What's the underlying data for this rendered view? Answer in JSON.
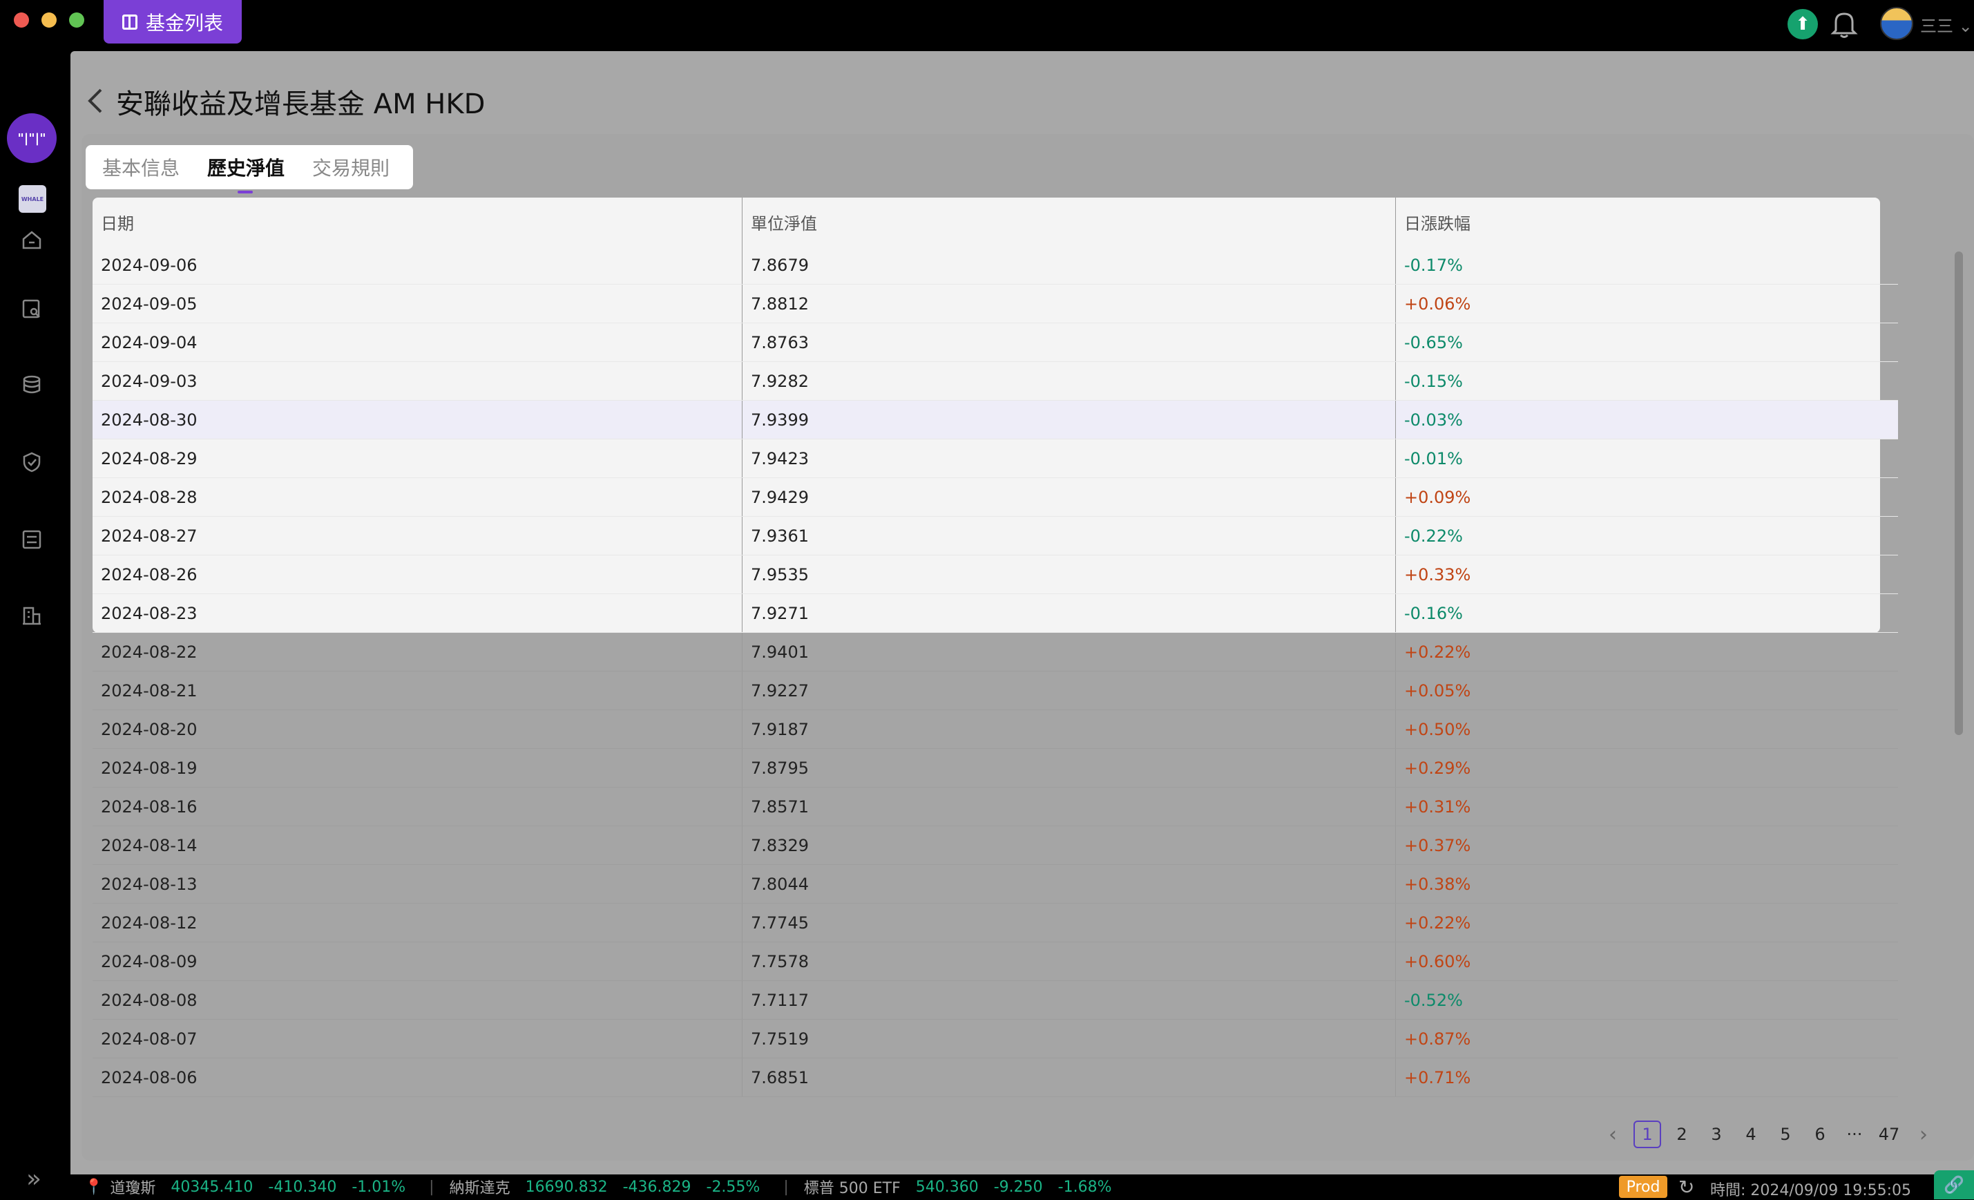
{
  "titlebar": {
    "tab_label": "基金列表",
    "username": "三三"
  },
  "sidebar": {
    "logo_text": "\"|\"|\"",
    "whale_text": "WHALE"
  },
  "page": {
    "title": "安聯收益及增長基金 AM HKD"
  },
  "tabs": [
    {
      "label": "基本信息"
    },
    {
      "label": "歷史淨值"
    },
    {
      "label": "交易規則"
    }
  ],
  "table": {
    "headers": {
      "date": "日期",
      "nav": "單位淨值",
      "change": "日漲跌幅"
    },
    "rows": [
      {
        "date": "2024-09-06",
        "nav": "7.8679",
        "change": "-0.17%"
      },
      {
        "date": "2024-09-05",
        "nav": "7.8812",
        "change": "+0.06%"
      },
      {
        "date": "2024-09-04",
        "nav": "7.8763",
        "change": "-0.65%"
      },
      {
        "date": "2024-09-03",
        "nav": "7.9282",
        "change": "-0.15%"
      },
      {
        "date": "2024-08-30",
        "nav": "7.9399",
        "change": "-0.03%"
      },
      {
        "date": "2024-08-29",
        "nav": "7.9423",
        "change": "-0.01%"
      },
      {
        "date": "2024-08-28",
        "nav": "7.9429",
        "change": "+0.09%"
      },
      {
        "date": "2024-08-27",
        "nav": "7.9361",
        "change": "-0.22%"
      },
      {
        "date": "2024-08-26",
        "nav": "7.9535",
        "change": "+0.33%"
      },
      {
        "date": "2024-08-23",
        "nav": "7.9271",
        "change": "-0.16%"
      },
      {
        "date": "2024-08-22",
        "nav": "7.9401",
        "change": "+0.22%"
      },
      {
        "date": "2024-08-21",
        "nav": "7.9227",
        "change": "+0.05%"
      },
      {
        "date": "2024-08-20",
        "nav": "7.9187",
        "change": "+0.50%"
      },
      {
        "date": "2024-08-19",
        "nav": "7.8795",
        "change": "+0.29%"
      },
      {
        "date": "2024-08-16",
        "nav": "7.8571",
        "change": "+0.31%"
      },
      {
        "date": "2024-08-14",
        "nav": "7.8329",
        "change": "+0.37%"
      },
      {
        "date": "2024-08-13",
        "nav": "7.8044",
        "change": "+0.38%"
      },
      {
        "date": "2024-08-12",
        "nav": "7.7745",
        "change": "+0.22%"
      },
      {
        "date": "2024-08-09",
        "nav": "7.7578",
        "change": "+0.60%"
      },
      {
        "date": "2024-08-08",
        "nav": "7.7117",
        "change": "-0.52%"
      },
      {
        "date": "2024-08-07",
        "nav": "7.7519",
        "change": "+0.87%"
      },
      {
        "date": "2024-08-06",
        "nav": "7.6851",
        "change": "+0.71%"
      }
    ]
  },
  "pager": {
    "pages": [
      "1",
      "2",
      "3",
      "4",
      "5",
      "6"
    ],
    "ellipsis": "···",
    "last": "47",
    "current": "1"
  },
  "ticker": [
    {
      "name": "道瓊斯",
      "value": "40345.410",
      "change": "-410.340",
      "pct": "-1.01%"
    },
    {
      "name": "納斯達克",
      "value": "16690.832",
      "change": "-436.829",
      "pct": "-2.55%"
    },
    {
      "name": "標普 500 ETF",
      "value": "540.360",
      "change": "-9.250",
      "pct": "-1.68%"
    }
  ],
  "status": {
    "env": "Prod",
    "clock": "時間: 2024/09/09 19:55:05"
  },
  "colors": {
    "accent": "#7b3fd6",
    "up": "#c04515",
    "down": "#0d8a6a"
  }
}
